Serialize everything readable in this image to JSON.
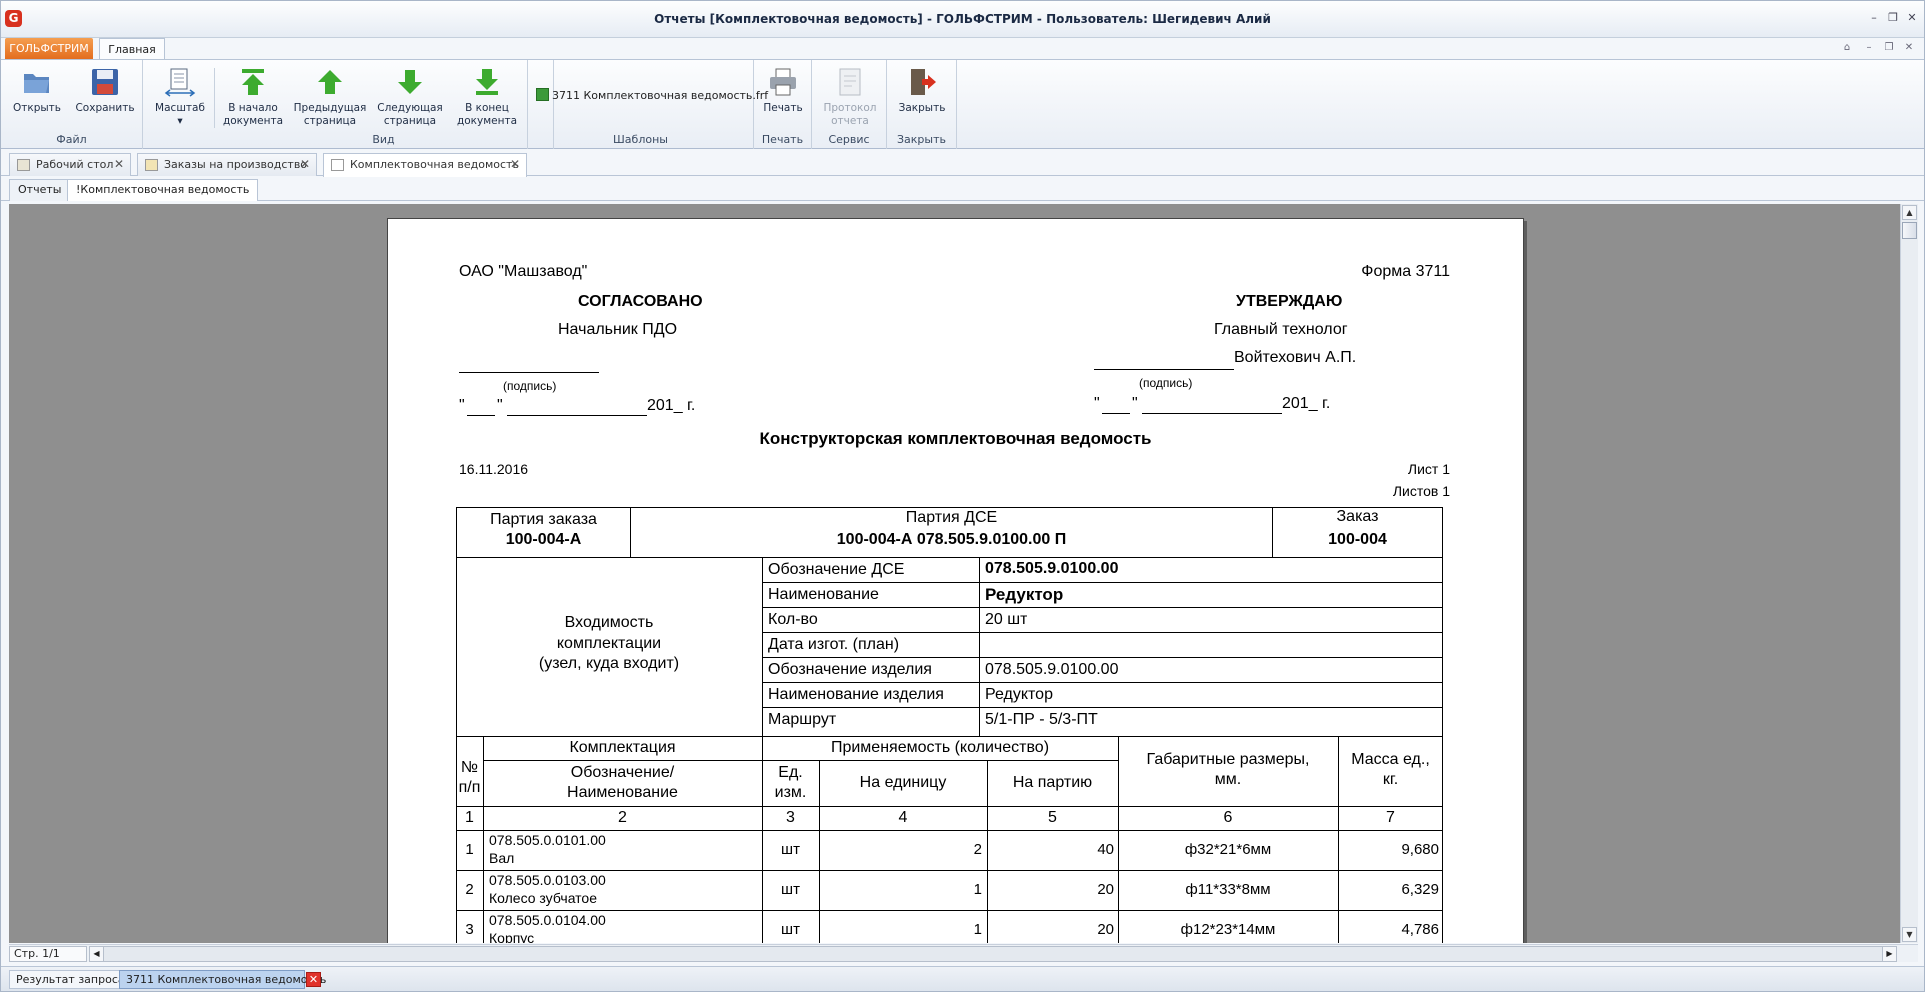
{
  "window": {
    "title": "Отчеты  [Комплектовочная ведомость] - ГОЛЬФСТРИМ - Пользователь: Шегидевич Алий",
    "logo_letter": "G"
  },
  "ribbon": {
    "app_menu": "ГОЛЬФСТРИМ",
    "tab_main": "Главная",
    "groups": {
      "file": "Файл",
      "view": "Вид",
      "templates": "Шаблоны",
      "print": "Печать",
      "service": "Сервис",
      "close": "Закрыть"
    },
    "buttons": {
      "open": "Открыть",
      "save": "Сохранить",
      "scale": "Масштаб",
      "first_page_1": "В начало",
      "first_page_2": "документа",
      "prev_page_1": "Предыдущая",
      "prev_page_2": "страница",
      "next_page_1": "Следующая",
      "next_page_2": "страница",
      "last_page_1": "В конец",
      "last_page_2": "документа",
      "template_file": "3711 Комплектовочная ведомость.frf",
      "print": "Печать",
      "report_log_1": "Протокол",
      "report_log_2": "отчета",
      "close": "Закрыть"
    }
  },
  "doc_tabs": [
    "Рабочий стол",
    "Заказы на производство",
    "Комплектовочная ведомость"
  ],
  "sub_tabs": [
    "Отчеты",
    "!Комплектовочная ведомость"
  ],
  "report": {
    "company": "ОАО \"Машзавод\"",
    "form": "Форма 3711",
    "agreed": "СОГЛАСОВАНО",
    "agreed_post": "Начальник ПДО",
    "approved": "УТВЕРЖДАЮ",
    "approved_post": "Главный технолог",
    "approved_name": "Войтехович А.П.",
    "signature_hint": "(подпись)",
    "date_quote_open": "\"",
    "date_quote_close": "\"",
    "date_year": "201_ г.",
    "doc_title": "Конструкторская комплектовочная ведомость",
    "date": "16.11.2016",
    "sheet": "Лист 1",
    "sheets": "Листов 1",
    "order_batch_label": "Партия заказа",
    "order_batch_value": "100-004-А",
    "dse_batch_label": "Партия ДСЕ",
    "dse_batch_value": "100-004-А 078.505.9.0100.00 П",
    "order_label": "Заказ",
    "order_value": "100-004",
    "membership_1": "Входимость",
    "membership_2": "комплектации",
    "membership_3": "(узел, куда входит)",
    "props": [
      {
        "label": "Обозначение ДСЕ",
        "value": "078.505.9.0100.00"
      },
      {
        "label": "Наименование",
        "value": "Редуктор"
      },
      {
        "label": "Кол-во",
        "value": "20 шт"
      },
      {
        "label": "Дата изгот. (план)",
        "value": ""
      },
      {
        "label": "Обозначение изделия",
        "value": "078.505.9.0100.00"
      },
      {
        "label": "Наименование изделия",
        "value": "Редуктор"
      },
      {
        "label": "Маршрут",
        "value": "5/1-ПР - 5/3-ПТ"
      }
    ],
    "head": {
      "num_1": "№",
      "num_2": "п/п",
      "kit": "Комплектация",
      "designation_1": "Обозначение/",
      "designation_2": "Наименование",
      "applicability": "Применяемость (количество)",
      "unit_1": "Ед.",
      "unit_2": "изм.",
      "per_unit": "На единицу",
      "per_batch": "На партию",
      "dims_1": "Габаритные размеры,",
      "dims_2": "мм.",
      "mass_1": "Масса ед.,",
      "mass_2": "кг."
    },
    "col_numbers": [
      "1",
      "2",
      "3",
      "4",
      "5",
      "6",
      "7"
    ],
    "rows": [
      {
        "n": "1",
        "code": "078.505.0.0101.00",
        "name": "Вал",
        "unit": "шт",
        "per_unit": "2",
        "per_batch": "40",
        "dims": "ф32*21*6мм",
        "mass": "9,680"
      },
      {
        "n": "2",
        "code": "078.505.0.0103.00",
        "name": "Колесо зубчатое",
        "unit": "шт",
        "per_unit": "1",
        "per_batch": "20",
        "dims": "ф11*33*8мм",
        "mass": "6,329"
      },
      {
        "n": "3",
        "code": "078.505.0.0104.00",
        "name": "Корпус",
        "unit": "шт",
        "per_unit": "1",
        "per_batch": "20",
        "dims": "ф12*23*14мм",
        "mass": "4,786"
      }
    ]
  },
  "status": {
    "page": "Стр. 1/1"
  },
  "taskbar": [
    "Результат запроса",
    "3711 Комплектовочная ведомость"
  ],
  "colors": {
    "brand": "#d8311f",
    "app_menu": "#e36d1e",
    "viewer_bg": "#8f8f8f",
    "arrow_green": "#3dab2f"
  }
}
